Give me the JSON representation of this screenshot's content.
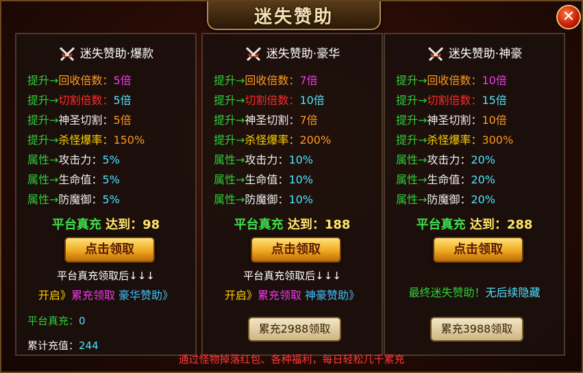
{
  "title": "迷失赞助",
  "close_label": "✕",
  "arrow": "→",
  "panels": [
    {
      "name": "迷失赞助·爆款",
      "rows": [
        {
          "prefix": "提升",
          "label": "回收倍数：",
          "value": "5倍"
        },
        {
          "prefix": "提升",
          "label": "切割倍数：",
          "value": "5倍"
        },
        {
          "prefix": "提升",
          "label": "神圣切割：",
          "value": "5倍"
        },
        {
          "prefix": "提升",
          "label": "杀怪爆率：",
          "value": "150%"
        },
        {
          "prefix": "属性",
          "label": "攻击力：",
          "value": "5%"
        },
        {
          "prefix": "属性",
          "label": "生命值：",
          "value": "5%"
        },
        {
          "prefix": "属性",
          "label": "防魔御：",
          "value": "5%"
        }
      ],
      "req_label": "平台真充",
      "req_text": " 达到：",
      "req_value": "98",
      "claim_label": "点击领取",
      "note1": "平台真充领取后↓↓↓",
      "open_a": "开启》",
      "open_b": "累充领取",
      "open_c": "豪华赞助》",
      "stat1_label": "平台真充：",
      "stat1_value": "0",
      "stat2_label": "累计充值：",
      "stat2_value": "244"
    },
    {
      "name": "迷失赞助·豪华",
      "rows": [
        {
          "prefix": "提升",
          "label": "回收倍数：",
          "value": "7倍"
        },
        {
          "prefix": "提升",
          "label": "切割倍数：",
          "value": "10倍"
        },
        {
          "prefix": "提升",
          "label": "神圣切割：",
          "value": "7倍"
        },
        {
          "prefix": "提升",
          "label": "杀怪爆率：",
          "value": "200%"
        },
        {
          "prefix": "属性",
          "label": "攻击力：",
          "value": "10%"
        },
        {
          "prefix": "属性",
          "label": "生命值：",
          "value": "10%"
        },
        {
          "prefix": "属性",
          "label": "防魔御：",
          "value": "10%"
        }
      ],
      "req_label": "平台真充",
      "req_text": " 达到：",
      "req_value": "188",
      "claim_label": "点击领取",
      "note1": "平台真充领取后↓↓↓",
      "open_a": "开启》",
      "open_b": "累充领取",
      "open_c": "神豪赞助》",
      "cum_label": "累充2988领取"
    },
    {
      "name": "迷失赞助·神豪",
      "rows": [
        {
          "prefix": "提升",
          "label": "回收倍数：",
          "value": "10倍"
        },
        {
          "prefix": "提升",
          "label": "切割倍数：",
          "value": "15倍"
        },
        {
          "prefix": "提升",
          "label": "神圣切割：",
          "value": "10倍"
        },
        {
          "prefix": "提升",
          "label": "杀怪爆率：",
          "value": "300%"
        },
        {
          "prefix": "属性",
          "label": "攻击力：",
          "value": "20%"
        },
        {
          "prefix": "属性",
          "label": "生命值：",
          "value": "20%"
        },
        {
          "prefix": "属性",
          "label": "防魔御：",
          "value": "20%"
        }
      ],
      "req_label": "平台真充",
      "req_text": " 达到：",
      "req_value": "288",
      "claim_label": "点击领取",
      "final_a": "最终迷失赞助！",
      "final_b": "无后续隐藏",
      "cum_label": "累充3988领取"
    }
  ],
  "footer": "通过怪物掉落红包、各种福利，每日轻松几千累充"
}
